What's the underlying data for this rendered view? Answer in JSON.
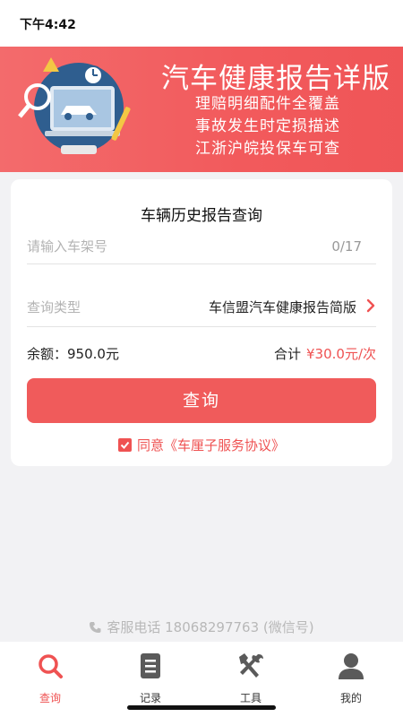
{
  "status_bar": {
    "time": "下午4:42"
  },
  "banner": {
    "title": "汽车健康报告详版",
    "lines": [
      "理赔明细配件全覆盖",
      "事故发生时定损描述",
      "江浙沪皖投保车可查"
    ]
  },
  "form": {
    "title": "车辆历史报告查询",
    "vin_placeholder": "请输入车架号",
    "vin_value": "",
    "vin_counter": "0/17",
    "type_label": "查询类型",
    "type_value": "车信盟汽车健康报告简版",
    "balance": "余额：950.0元",
    "total_label": "合计",
    "total_price": "¥30.0元/次",
    "submit_label": "查询",
    "agreement": "同意《车厘子服务协议》",
    "agreement_checked": true
  },
  "service": {
    "text": "客服电话 18068297763 (微信号)"
  },
  "tabbar": {
    "items": [
      {
        "label": "查询",
        "icon": "search-icon",
        "active": true
      },
      {
        "label": "记录",
        "icon": "document-icon",
        "active": false
      },
      {
        "label": "工具",
        "icon": "tools-icon",
        "active": false
      },
      {
        "label": "我的",
        "icon": "user-icon",
        "active": false
      }
    ]
  },
  "colors": {
    "accent": "#f05b5b",
    "banner": "#f36b6c",
    "background": "#f2f2f4"
  }
}
